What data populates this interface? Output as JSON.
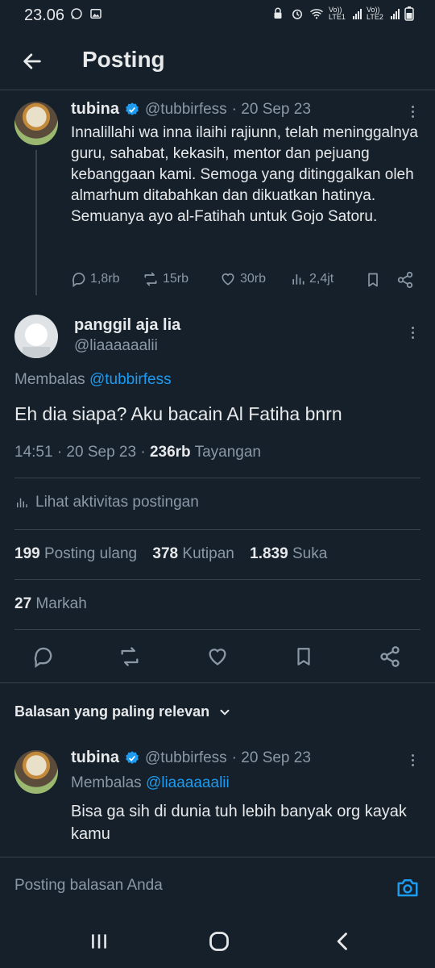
{
  "status_bar": {
    "time": "23.06",
    "net1": "Vo)) LTE1",
    "net2": "Vo)) LTE2"
  },
  "header": {
    "title": "Posting"
  },
  "original_tweet": {
    "name": "tubina",
    "handle": "@tubbirfess",
    "date": "· 20 Sep 23",
    "text": "Innalillahi wa inna ilaihi rajiunn, telah meninggalnya guru, sahabat, kekasih, mentor dan pejuang kebanggaan kami. Semoga yang ditinggalkan oleh almarhum ditabahkan dan dikuatkan hatinya. Semuanya ayo al-Fatihah untuk Gojo Satoru.",
    "replies": "1,8rb",
    "retweets": "15rb",
    "likes": "30rb",
    "views": "2,4jt"
  },
  "main_tweet": {
    "name": "panggil aja lia",
    "handle": "@liaaaaaalii",
    "replying_label": "Membalas",
    "replying_to": "@tubbirfess",
    "text": "Eh dia siapa? Aku bacain Al Fatiha bnrn",
    "timestamp": "14:51 · 20 Sep 23 ·",
    "views_count": "236rb",
    "views_label": "Tayangan",
    "activity_label": "Lihat aktivitas postingan",
    "reposts_count": "199",
    "reposts_label": "Posting ulang",
    "quotes_count": "378",
    "quotes_label": "Kutipan",
    "likes_count": "1.839",
    "likes_label": "Suka",
    "bookmarks_count": "27",
    "bookmarks_label": "Markah"
  },
  "replies_section": {
    "sort_label": "Balasan yang paling relevan"
  },
  "reply_tweet": {
    "name": "tubina",
    "handle": "@tubbirfess",
    "date": "· 20 Sep 23",
    "replying_label": "Membalas",
    "replying_to": "@liaaaaaalii",
    "text": "Bisa ga sih di dunia tuh lebih banyak org kayak kamu"
  },
  "reply_input": {
    "placeholder": "Posting balasan Anda"
  },
  "colors": {
    "background": "#15202b",
    "accent": "#1d9bf0",
    "muted": "#8b98a5",
    "divider": "#38444d"
  }
}
